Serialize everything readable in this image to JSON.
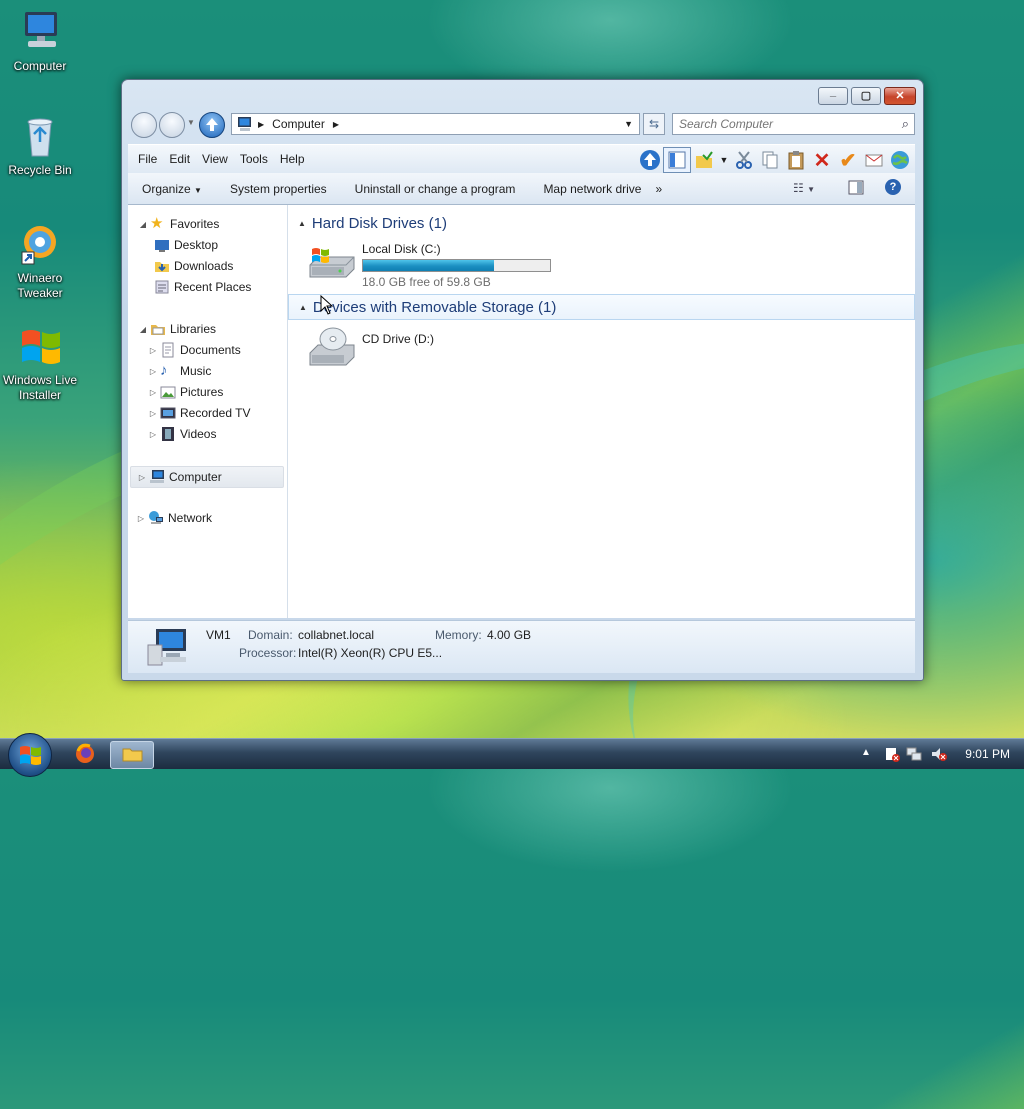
{
  "desktop": {
    "icons": [
      {
        "label": "Computer"
      },
      {
        "label": "Recycle Bin"
      },
      {
        "label": "Winaero Tweaker"
      },
      {
        "label": "Windows Live Installer"
      }
    ]
  },
  "window": {
    "address": {
      "crumb": "Computer"
    },
    "search": {
      "placeholder": "Search Computer"
    },
    "menu": [
      "File",
      "Edit",
      "View",
      "Tools",
      "Help"
    ],
    "commands": {
      "organize": "Organize",
      "system_properties": "System properties",
      "uninstall": "Uninstall or change a program",
      "map_drive": "Map network drive",
      "more": "»"
    },
    "nav": {
      "favorites": "Favorites",
      "desktop": "Desktop",
      "downloads": "Downloads",
      "recent": "Recent Places",
      "libraries": "Libraries",
      "documents": "Documents",
      "music": "Music",
      "pictures": "Pictures",
      "recorded_tv": "Recorded TV",
      "videos": "Videos",
      "computer": "Computer",
      "network": "Network"
    },
    "groups": {
      "hdd": "Hard Disk Drives (1)",
      "removable": "Devices with Removable Storage (1)"
    },
    "drives": {
      "c": {
        "name": "Local Disk (C:)",
        "free": "18.0 GB free of 59.8 GB",
        "used_fraction": 0.7
      },
      "d": {
        "name": "CD Drive (D:)"
      }
    },
    "details": {
      "name": "VM1",
      "domain_label": "Domain:",
      "domain_value": "collabnet.local",
      "memory_label": "Memory:",
      "memory_value": "4.00 GB",
      "processor_label": "Processor:",
      "processor_value": "Intel(R) Xeon(R) CPU E5..."
    }
  },
  "taskbar": {
    "clock": "9:01 PM"
  },
  "colors": {
    "accent": "#1c63b8",
    "group_text": "#1e3d78",
    "bar_fill": "#1b8fc1"
  }
}
